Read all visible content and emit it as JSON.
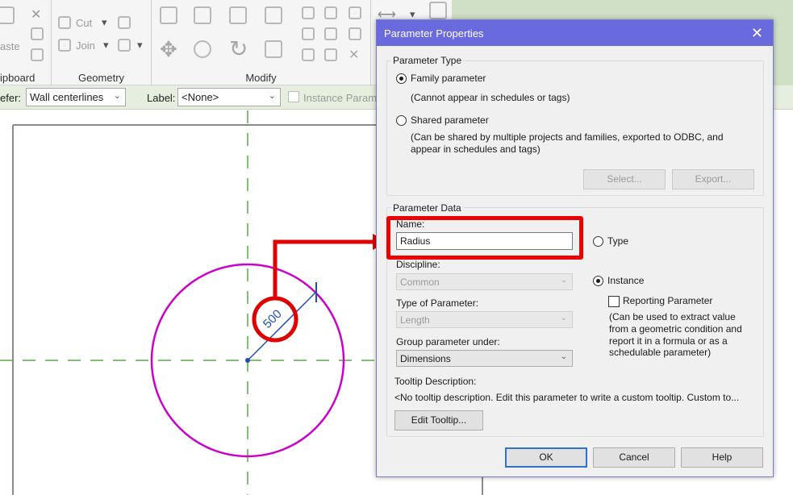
{
  "ribbon": {
    "clipboard": {
      "paste_label": "aste",
      "label": "ipboard"
    },
    "geometry": {
      "cut_label": "Cut",
      "join_label": "Join",
      "label": "Geometry"
    },
    "modify": {
      "label": "Modify"
    }
  },
  "options_bar": {
    "refer_label": "efer:",
    "refer_value": "Wall centerlines",
    "label_label": "Label:",
    "label_value": "<None>",
    "instance_param_label": "Instance Param"
  },
  "canvas": {
    "dimension_value": "500",
    "colors": {
      "circle": "#cc00cc",
      "dimension": "#1f4fb0",
      "centerline": "#5aa84a",
      "callout": "#e00000"
    }
  },
  "dialog": {
    "title": "Parameter Properties",
    "close_glyph": "✕",
    "parameter_type": {
      "label": "Parameter Type",
      "family_label": "Family parameter",
      "family_note": "(Cannot appear in schedules or tags)",
      "shared_label": "Shared parameter",
      "shared_note_1": "(Can be shared by multiple projects and families, exported to ODBC, and",
      "shared_note_2": "appear in schedules and tags)",
      "select_button": "Select...",
      "export_button": "Export..."
    },
    "parameter_data": {
      "label": "Parameter Data",
      "name_label": "Name:",
      "name_value": "Radius",
      "discipline_label": "Discipline:",
      "discipline_value": "Common",
      "type_of_param_label": "Type of Parameter:",
      "type_of_param_value": "Length",
      "group_label": "Group parameter under:",
      "group_value": "Dimensions",
      "type_radio": "Type",
      "instance_radio": "Instance",
      "reporting_label": "Reporting Parameter",
      "reporting_note_1": "(Can be used to extract value",
      "reporting_note_2": "from a geometric condition and",
      "reporting_note_3": "report it in a formula or as a",
      "reporting_note_4": "schedulable parameter)",
      "tooltip_label": "Tooltip Description:",
      "tooltip_value": "<No tooltip description. Edit this parameter to write a custom tooltip. Custom to...",
      "edit_tooltip_button": "Edit Tooltip..."
    },
    "buttons": {
      "ok": "OK",
      "cancel": "Cancel",
      "help": "Help"
    }
  }
}
